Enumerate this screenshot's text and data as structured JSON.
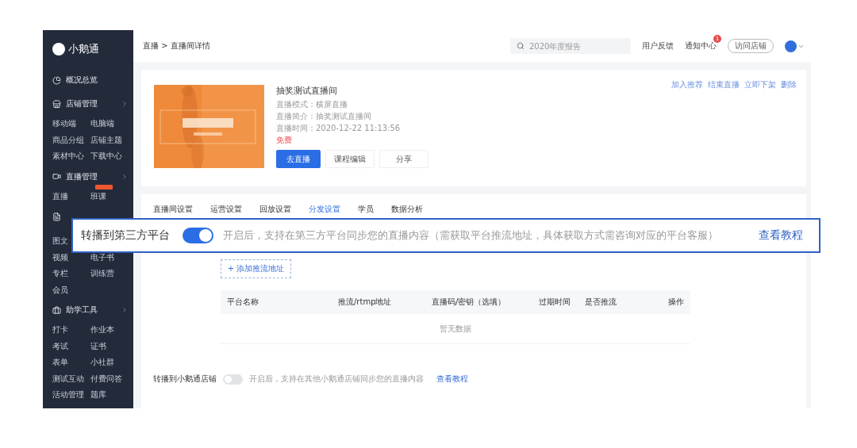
{
  "logo": {
    "text": "小鹅通"
  },
  "sidebar": {
    "sections": [
      {
        "title": "概况总览",
        "expandable": false
      },
      {
        "title": "店铺管理",
        "expandable": true,
        "rows": [
          [
            "移动端",
            "电脑端"
          ],
          [
            "商品分组",
            "店铺主题"
          ],
          [
            "素材中心",
            "下载中心"
          ]
        ]
      },
      {
        "title": "直播管理",
        "expandable": true,
        "rows": [
          [
            "直播",
            {
              "label": "班课",
              "badge": true
            }
          ]
        ]
      },
      {
        "rows": [
          [
            "图文"
          ],
          [
            "视频",
            "电子书"
          ],
          [
            "专栏",
            "训练营"
          ],
          [
            "会员"
          ]
        ]
      },
      {
        "title": "助学工具",
        "expandable": true,
        "rows": [
          [
            "打卡",
            "作业本"
          ],
          [
            "考试",
            "证书"
          ],
          [
            "表单",
            "小社群"
          ],
          [
            "测试互动",
            "付费问答"
          ],
          [
            "活动管理",
            "题库"
          ]
        ]
      }
    ]
  },
  "header": {
    "breadcrumb": "直播 > 直播间详情",
    "search": {
      "placeholder": "2020年度报告"
    },
    "links": [
      "用户反馈",
      "通知中心"
    ],
    "notification_count": "1",
    "visit_button": "访问店铺"
  },
  "room": {
    "title": "抽奖测试直播间",
    "cover": {
      "kind": "picture"
    },
    "meta": [
      "直播模式：横屏直播",
      "直播简介：抽奖测试直播间",
      "直播时间：2020-12-22 11:13:56"
    ],
    "price": "免费",
    "buttons": [
      {
        "label": "去直播",
        "primary": true
      },
      {
        "label": "课程编辑",
        "primary": false
      },
      {
        "label": "分享",
        "primary": false
      }
    ],
    "actions": [
      "加入推荐",
      "结束直播",
      "立即下架",
      "删除"
    ]
  },
  "tabs": [
    {
      "label": "直播间设置",
      "selected": false
    },
    {
      "label": "运营设置",
      "selected": false
    },
    {
      "label": "回放设置",
      "selected": false
    },
    {
      "label": "分发设置",
      "selected": true
    },
    {
      "label": "学员",
      "selected": false
    },
    {
      "label": "数据分析",
      "selected": false
    }
  ],
  "callout": {
    "label": "转播到第三方平台",
    "on": true,
    "description": "开启后，支持在第三方平台同步您的直播内容（需获取平台推流地址，具体获取方式需咨询对应的平台客服）",
    "link": "查看教程"
  },
  "add_button": "+ 添加推流地址",
  "table": {
    "columns": [
      "平台名称",
      "推流/rtmp地址",
      "直播码/密钥（选填）",
      "过期时间",
      "是否推流",
      "操作"
    ],
    "empty": "暂无数据"
  },
  "store_relay": {
    "label": "转播到小鹅通店铺",
    "on": false,
    "description": "开启后，支持在其他小鹅通店铺同步您的直播内容",
    "link": "查看教程"
  }
}
